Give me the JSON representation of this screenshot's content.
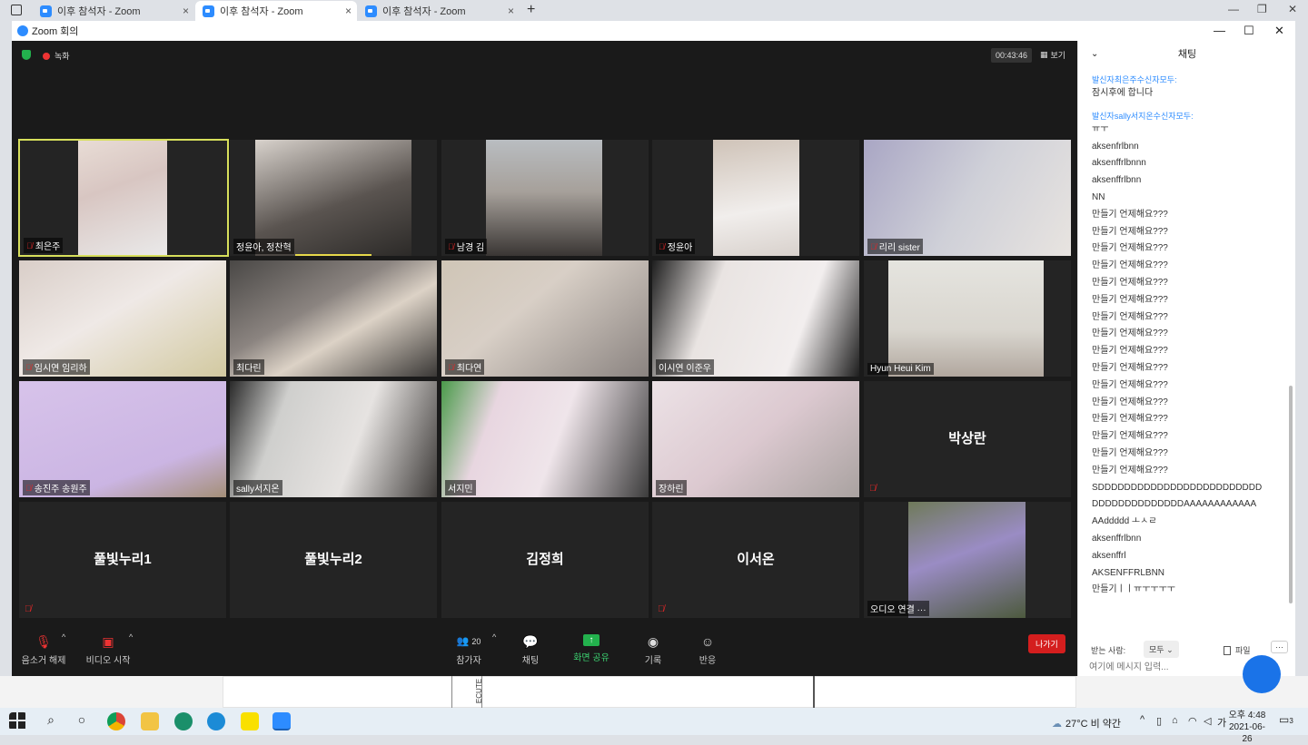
{
  "browser": {
    "tabs": [
      {
        "title": "이후 참석자 - Zoom"
      },
      {
        "title": "이후 참석자 - Zoom"
      },
      {
        "title": "이후 참석자 - Zoom"
      }
    ],
    "new_tab": "+",
    "close": "×"
  },
  "window": {
    "title": "Zoom 회의",
    "minimize": "—",
    "maximize": "☐",
    "close": "✕"
  },
  "meeting": {
    "recording_label": "녹화",
    "timer": "00:43:46",
    "view_label": "보기"
  },
  "tiles": [
    {
      "name": "최은주",
      "muted": true
    },
    {
      "name": "정윤아, 정찬혁",
      "muted": false
    },
    {
      "name": "남경 김",
      "muted": true
    },
    {
      "name": "정윤아",
      "muted": true
    },
    {
      "name": "리리 sister",
      "muted": true
    },
    {
      "name": "임시연 임리하",
      "muted": true
    },
    {
      "name": "최다린",
      "muted": false
    },
    {
      "name": "최다연",
      "muted": true
    },
    {
      "name": "이시연 이준우",
      "muted": false
    },
    {
      "name": "Hyun Heui Kim",
      "muted": false
    },
    {
      "name": "송진주 송원주",
      "muted": true
    },
    {
      "name": "sally서지온",
      "muted": false
    },
    {
      "name": "서지민",
      "muted": false
    },
    {
      "name": "장하린",
      "muted": false
    },
    {
      "name": "박상란",
      "muted": true,
      "name_only": true
    },
    {
      "name": "풀빛누리1",
      "muted": true,
      "name_only": true
    },
    {
      "name": "풀빛누리2",
      "muted": false,
      "name_only": true
    },
    {
      "name": "김정희",
      "muted": false,
      "name_only": true
    },
    {
      "name": "이서온",
      "muted": true,
      "name_only": true
    },
    {
      "name": "오디오 연결 ···",
      "muted": false
    }
  ],
  "toolbar": {
    "unmute": "음소거 해제",
    "start_video": "비디오 시작",
    "participants": "참가자",
    "participant_count": "20",
    "chat": "채팅",
    "share_screen": "화면 공유",
    "record": "기록",
    "reactions": "반응",
    "leave": "나가기"
  },
  "chat": {
    "title": "채팅",
    "messages": [
      {
        "meta": "발신자최은주수신자모두:",
        "lines": [
          "잠시후에 합니다"
        ]
      },
      {
        "meta": "발신자sally서지온수신자모두:",
        "lines": [
          "ㅠㅜ",
          "aksenfrlbnn",
          "aksenffrlbnnn",
          "aksenffrlbnn",
          "NN",
          "만들기 언제해요???",
          "만들기 언제해요???",
          "만들기 언제해요???",
          "만들기 언제해요???",
          "만들기 언제해요???",
          "만들기 언제해요???",
          "만들기 언제해요???",
          "만들기 언제해요???",
          "만들기 언제해요???",
          "만들기 언제해요???",
          "만들기 언제해요???",
          "만들기 언제해요???",
          "만들기 언제해요???",
          "만들기 언제해요???",
          "만들기 언제해요???",
          "만들기 언제해요???",
          "SDDDDDDDDDDDDDDDDDDDDDDDDD",
          "DDDDDDDDDDDDDDAAAAAAAAAAAA",
          "AAddddd ㅗㅅㄹ",
          "aksenffrlbnn",
          "aksenffrl",
          "AKSENFFRLBNN",
          "만들기ㅣㅣㅠㅜㅜㅜㅜ"
        ]
      }
    ],
    "to_label": "받는 사람:",
    "to_value": "모두",
    "file_label": "파일",
    "more": "···",
    "input_placeholder": "여기에 메시지 입력..."
  },
  "taskbar": {
    "weather": "27°C  비 약간",
    "ime": "가",
    "time": "오후 4:48",
    "date": "2021-06-26",
    "notif_count": "3"
  },
  "behind_text": "ECUTE"
}
